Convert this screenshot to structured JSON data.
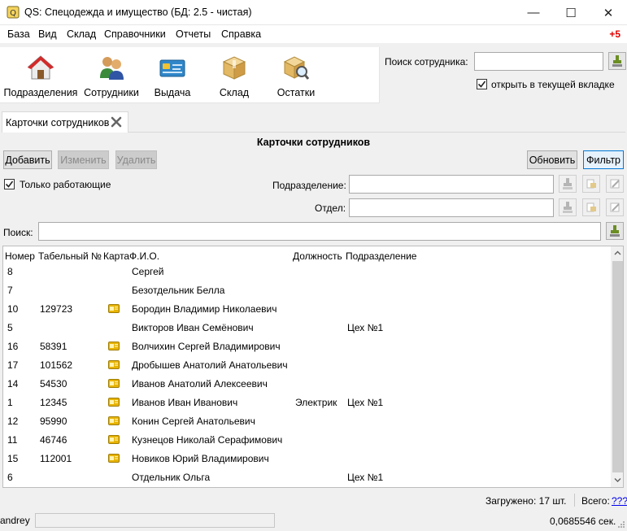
{
  "window": {
    "title": "QS: Спецодежда и имущество (БД: 2.5 - чистая)",
    "minimize_glyph": "—",
    "maximize_glyph": "☐",
    "close_glyph": "✕"
  },
  "menu": {
    "items": [
      "База",
      "Вид",
      "Склад",
      "Справочники",
      "Отчеты",
      "Справка"
    ],
    "badge": "+5"
  },
  "toolbar": {
    "buttons": [
      {
        "label": "Подразделения",
        "icon": "house-icon"
      },
      {
        "label": "Сотрудники",
        "icon": "people-icon"
      },
      {
        "label": "Выдача",
        "icon": "id-card-icon"
      },
      {
        "label": "Склад",
        "icon": "box-icon"
      },
      {
        "label": "Остатки",
        "icon": "box-search-icon"
      }
    ]
  },
  "employee_search": {
    "label": "Поиск сотрудника:",
    "value": "",
    "open_in_current_tab_label": "открыть в текущей вкладке",
    "open_in_current_tab_checked": true
  },
  "tab": {
    "label": "Карточки сотрудников"
  },
  "section": {
    "title": "Карточки сотрудников"
  },
  "actions": {
    "add": "Добавить",
    "edit": "Изменить",
    "delete": "Удалить",
    "refresh": "Обновить",
    "filter": "Фильтр"
  },
  "filters": {
    "only_working_label": "Только работающие",
    "only_working_checked": true,
    "department_label": "Подразделение:",
    "department_value": "",
    "section_label": "Отдел:",
    "section_value": "",
    "search_label": "Поиск:",
    "search_value": ""
  },
  "table": {
    "columns": [
      "Номер",
      "Табельный №",
      "Карта",
      "Ф.И.О.",
      "Должность",
      "Подразделение"
    ],
    "rows": [
      {
        "number": "8",
        "tab_no": "",
        "card": false,
        "fio": " Сергей",
        "position": "",
        "department": ""
      },
      {
        "number": "7",
        "tab_no": "",
        "card": false,
        "fio": "Безотдельник Белла",
        "position": "",
        "department": ""
      },
      {
        "number": "10",
        "tab_no": "129723",
        "card": true,
        "fio": "Бородин Владимир Николаевич",
        "position": "",
        "department": ""
      },
      {
        "number": "5",
        "tab_no": "",
        "card": false,
        "fio": "Викторов Иван Семёнович",
        "position": "",
        "department": "Цех №1"
      },
      {
        "number": "16",
        "tab_no": "58391",
        "card": true,
        "fio": "Волчихин Сергей Владимирович",
        "position": "",
        "department": ""
      },
      {
        "number": "17",
        "tab_no": "101562",
        "card": true,
        "fio": "Дробышев Анатолий Анатольевич",
        "position": "",
        "department": ""
      },
      {
        "number": "14",
        "tab_no": "54530",
        "card": true,
        "fio": "Иванов Анатолий Алексеевич",
        "position": "",
        "department": ""
      },
      {
        "number": "1",
        "tab_no": "12345",
        "card": true,
        "fio": "Иванов Иван Иванович",
        "position": "Электрик",
        "department": "Цех №1"
      },
      {
        "number": "12",
        "tab_no": "95990",
        "card": true,
        "fio": "Конин Сергей Анатольевич",
        "position": "",
        "department": ""
      },
      {
        "number": "11",
        "tab_no": "46746",
        "card": true,
        "fio": "Кузнецов Николай Серафимович",
        "position": "",
        "department": ""
      },
      {
        "number": "15",
        "tab_no": "112001",
        "card": true,
        "fio": "Новиков Юрий Владимирович",
        "position": "",
        "department": ""
      },
      {
        "number": "6",
        "tab_no": "",
        "card": false,
        "fio": "Отдельник  Ольга",
        "position": "",
        "department": "Цех №1"
      }
    ]
  },
  "status": {
    "loaded": "Загружено: 17 шт.",
    "total_label": "Всего:",
    "total_value": "???",
    "user": "andrey",
    "timing": "0,0685546 сек."
  },
  "colors": {
    "accent_blue": "#0078d7",
    "badge_red": "#e00000",
    "card_icon": "#e8b400"
  }
}
